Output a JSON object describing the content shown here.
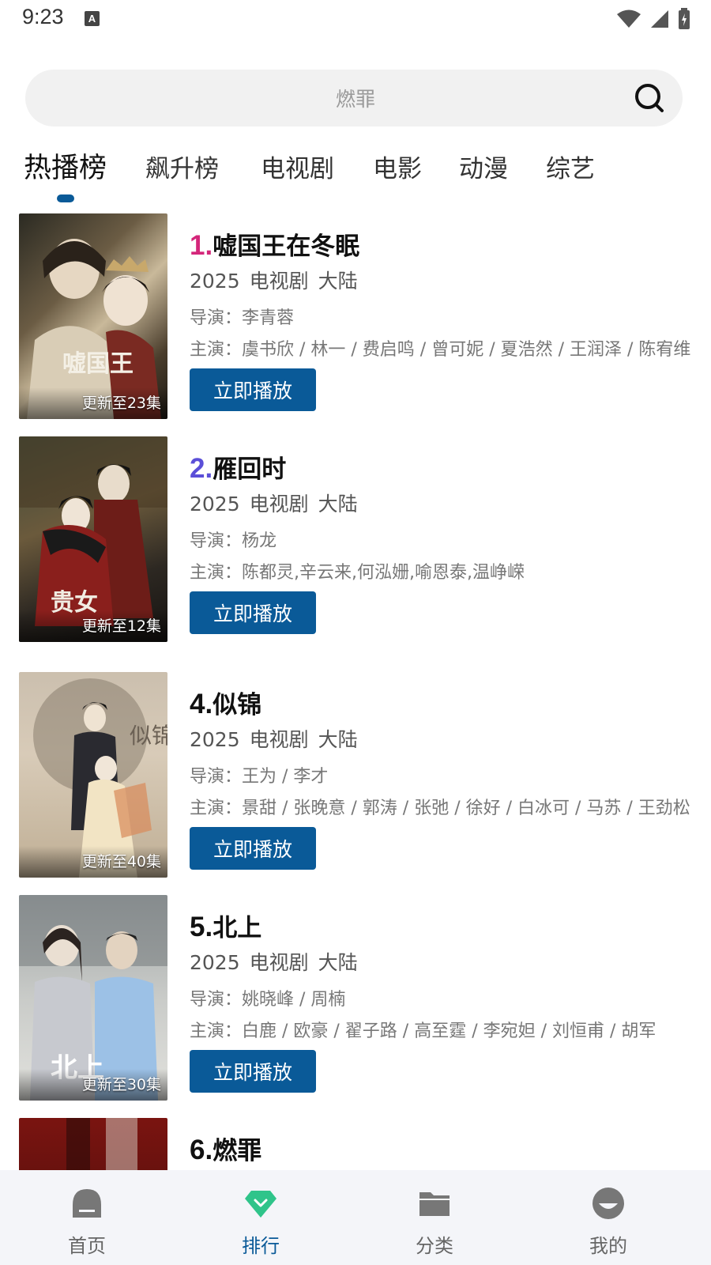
{
  "status_bar": {
    "time": "9:23",
    "notification": "A"
  },
  "search": {
    "placeholder": "燃罪"
  },
  "tabs": [
    {
      "label": "热播榜",
      "active": true
    },
    {
      "label": "飙升榜",
      "active": false
    },
    {
      "label": "电视剧",
      "active": false
    },
    {
      "label": "电影",
      "active": false
    },
    {
      "label": "动漫",
      "active": false
    },
    {
      "label": "综艺",
      "active": false
    }
  ],
  "items": [
    {
      "rank": "1.",
      "rank_color": "#d4267a",
      "title": "嘘国王在冬眠",
      "year": "2025",
      "type": "电视剧",
      "region": "大陆",
      "director": "导演：李青蓉",
      "cast": "主演：虞书欣 / 林一 / 费启鸣 / 曾可妮 / 夏浩然 / 王润泽 / 陈宥维",
      "update": "更新至23集",
      "play": "立即播放"
    },
    {
      "rank": "2.",
      "rank_color": "#5b4fd8",
      "title": "雁回时",
      "year": "2025",
      "type": "电视剧",
      "region": "大陆",
      "director": "导演：杨龙",
      "cast": "主演：陈都灵,辛云来,何泓姗,喻恩泰,温峥嵘",
      "update": "更新至12集",
      "play": "立即播放"
    },
    {
      "rank": "4.",
      "rank_color": "#111111",
      "title": "似锦",
      "year": "2025",
      "type": "电视剧",
      "region": "大陆",
      "director": "导演：王为 / 李才",
      "cast": "主演：景甜 / 张晚意 / 郭涛 / 张弛 / 徐好 / 白冰可 / 马苏 / 王劲松",
      "update": "更新至40集",
      "play": "立即播放"
    },
    {
      "rank": "5.",
      "rank_color": "#111111",
      "title": "北上",
      "year": "2025",
      "type": "电视剧",
      "region": "大陆",
      "director": "导演：姚晓峰 / 周楠",
      "cast": "主演：白鹿 / 欧豪 / 翟子路 / 高至霆 / 李宛妲 / 刘恒甫 / 胡军",
      "update": "更新至30集",
      "play": "立即播放"
    },
    {
      "rank": "6.",
      "rank_color": "#111111",
      "title": "燃罪",
      "year": "",
      "type": "",
      "region": "",
      "director": "",
      "cast": "",
      "update": "",
      "play": ""
    }
  ],
  "bottom_nav": [
    {
      "label": "首页",
      "icon": "home-icon",
      "active": false
    },
    {
      "label": "排行",
      "icon": "ranking-diamond-icon",
      "active": true
    },
    {
      "label": "分类",
      "icon": "folder-icon",
      "active": false
    },
    {
      "label": "我的",
      "icon": "profile-icon",
      "active": false
    }
  ],
  "colors": {
    "accent": "#0a5a98",
    "active_nav": "#2fc48a"
  }
}
